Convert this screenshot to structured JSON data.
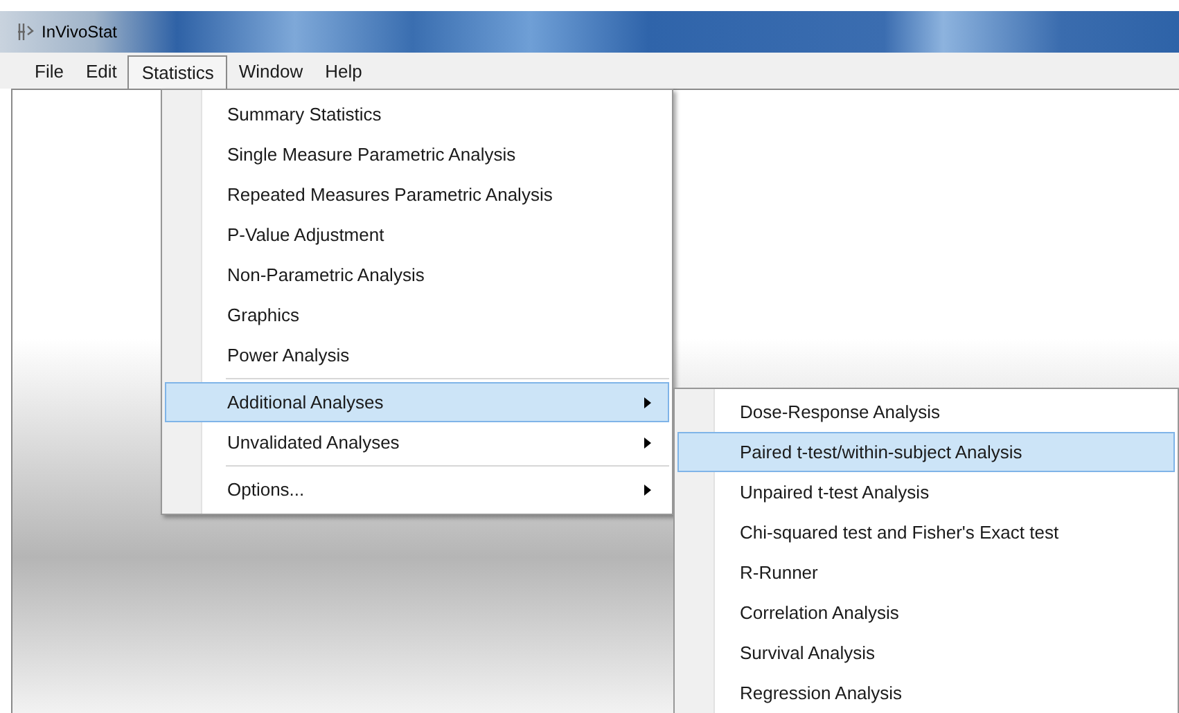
{
  "window": {
    "title": "InVivoStat"
  },
  "menubar": [
    {
      "label": "File",
      "selected": false
    },
    {
      "label": "Edit",
      "selected": false
    },
    {
      "label": "Statistics",
      "selected": true
    },
    {
      "label": "Window",
      "selected": false
    },
    {
      "label": "Help",
      "selected": false
    }
  ],
  "statistics_menu": [
    {
      "kind": "item",
      "label": "Summary Statistics",
      "selected": false,
      "submenu": false
    },
    {
      "kind": "item",
      "label": "Single Measure Parametric Analysis",
      "selected": false,
      "submenu": false
    },
    {
      "kind": "item",
      "label": "Repeated Measures Parametric Analysis",
      "selected": false,
      "submenu": false
    },
    {
      "kind": "item",
      "label": "P-Value Adjustment",
      "selected": false,
      "submenu": false
    },
    {
      "kind": "item",
      "label": "Non-Parametric Analysis",
      "selected": false,
      "submenu": false
    },
    {
      "kind": "item",
      "label": "Graphics",
      "selected": false,
      "submenu": false
    },
    {
      "kind": "item",
      "label": "Power Analysis",
      "selected": false,
      "submenu": false
    },
    {
      "kind": "separator"
    },
    {
      "kind": "item",
      "label": "Additional Analyses",
      "selected": true,
      "submenu": true
    },
    {
      "kind": "item",
      "label": "Unvalidated Analyses",
      "selected": false,
      "submenu": true
    },
    {
      "kind": "separator"
    },
    {
      "kind": "item",
      "label": "Options...",
      "selected": false,
      "submenu": true
    }
  ],
  "additional_analyses_menu": [
    {
      "label": "Dose-Response Analysis",
      "selected": false
    },
    {
      "label": "Paired t-test/within-subject Analysis",
      "selected": true
    },
    {
      "label": "Unpaired t-test Analysis",
      "selected": false
    },
    {
      "label": "Chi-squared test and Fisher's Exact test",
      "selected": false
    },
    {
      "label": "R-Runner",
      "selected": false
    },
    {
      "label": "Correlation Analysis",
      "selected": false
    },
    {
      "label": "Survival Analysis",
      "selected": false
    },
    {
      "label": "Regression Analysis",
      "selected": false
    }
  ]
}
